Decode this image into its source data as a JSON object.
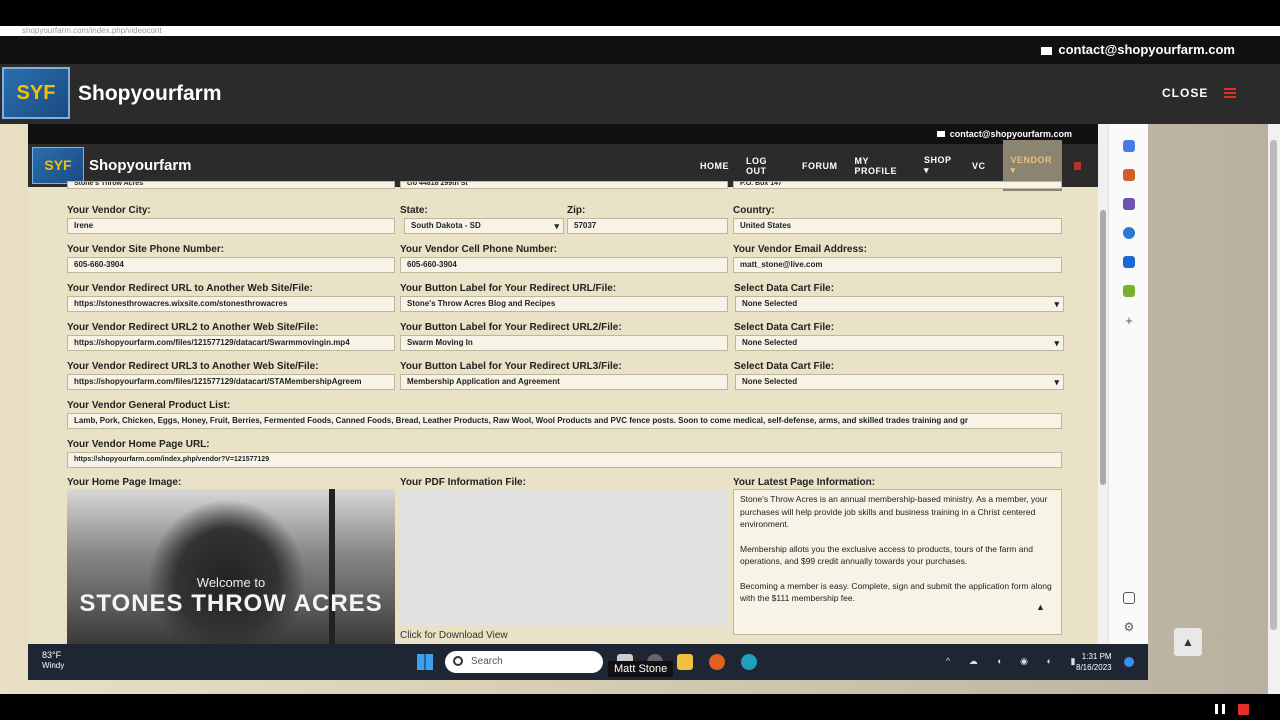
{
  "browser": {
    "url": "shopyourfarm.com/index.php/videocont"
  },
  "outer": {
    "contact_email": "contact@shopyourfarm.com",
    "logo_text": "SYF",
    "brand": "Shopyourfarm",
    "close_label": "CLOSE"
  },
  "inner": {
    "contact_email": "contact@shopyourfarm.com",
    "logo_text": "SYF",
    "brand": "Shopyourfarm",
    "menu": {
      "home": "HOME",
      "logout": "LOG OUT",
      "forum": "FORUM",
      "profile": "MY PROFILE",
      "shop": "SHOP ▾",
      "vc": "VC",
      "vendor": "VENDOR ▾"
    }
  },
  "form": {
    "partial_top": {
      "name": "Stone's Throw Acres",
      "address": "c/o 44818 299th St",
      "po_box": "P.O. Box 147"
    },
    "city": {
      "label": "Your Vendor City:",
      "value": "Irene"
    },
    "state": {
      "label": "State:",
      "value": "South Dakota - SD"
    },
    "zip": {
      "label": "Zip:",
      "value": "57037"
    },
    "country": {
      "label": "Country:",
      "value": "United States"
    },
    "site_phone": {
      "label": "Your Vendor Site Phone Number:",
      "value": "605-660-3904"
    },
    "cell_phone": {
      "label": "Your Vendor Cell Phone Number:",
      "value": "605-660-3904"
    },
    "email": {
      "label": "Your Vendor Email Address:",
      "value": "matt_stone@live.com"
    },
    "redirect1": {
      "label": "Your Vendor Redirect URL to Another Web Site/File:",
      "value": "https://stonesthrowacres.wixsite.com/stonesthrowacres"
    },
    "button1": {
      "label": "Your Button Label for Your Redirect URL/File:",
      "value": "Stone's Throw Acres Blog and Recipes"
    },
    "datacart1": {
      "label": "Select Data Cart File:",
      "value": "None Selected"
    },
    "redirect2": {
      "label": "Your Vendor Redirect URL2 to Another Web Site/File:",
      "value": "https://shopyourfarm.com/files/121577129/datacart/Swarmmovingin.mp4"
    },
    "button2": {
      "label": "Your Button Label for Your Redirect URL2/File:",
      "value": "Swarm Moving In"
    },
    "datacart2": {
      "label": "Select Data Cart File:",
      "value": "None Selected"
    },
    "redirect3": {
      "label": "Your Vendor Redirect URL3 to Another Web Site/File:",
      "value": "https://shopyourfarm.com/files/121577129/datacart/STAMembershipAgreem"
    },
    "button3": {
      "label": "Your Button Label for Your Redirect URL3/File:",
      "value": "Membership Application and Agreement"
    },
    "datacart3": {
      "label": "Select Data Cart File:",
      "value": "None Selected"
    },
    "product_list": {
      "label": "Your Vendor General Product List:",
      "value": "Lamb, Pork, Chicken, Eggs, Honey, Fruit, Berries, Fermented Foods, Canned Foods, Bread, Leather Products, Raw Wool, Wool Products and PVC fence posts.  Soon to come medical, self-defense, arms, and skilled trades training and gr"
    },
    "home_url": {
      "label": "Your Vendor Home Page URL:",
      "value": "https://shopyourfarm.com/index.php/vendor?V=121577129"
    },
    "home_image": {
      "label": "Your Home Page Image:",
      "welcome": "Welcome to",
      "title": "STONES THROW ACRES"
    },
    "pdf": {
      "label": "Your PDF Information File:",
      "download": "Click for Download View"
    },
    "latest": {
      "label": "Your Latest Page Information:",
      "p1": "Stone's Throw Acres is an annual membership-based ministry.  As a member, your purchases will help provide job skills and business training in a Christ centered environment.",
      "p2": "Membership allots you the exclusive access to products, tours of the farm and operations, and $99 credit annually towards your purchases.",
      "p3": "Becoming a member is easy.  Complete, sign and submit the application form along with the $111 membership fee."
    }
  },
  "taskbar": {
    "temp": "83°F",
    "condition": "Windy",
    "search_placeholder": "Search",
    "tooltip": "Matt Stone",
    "time": "1:31 PM",
    "date": "8/16/2023"
  }
}
